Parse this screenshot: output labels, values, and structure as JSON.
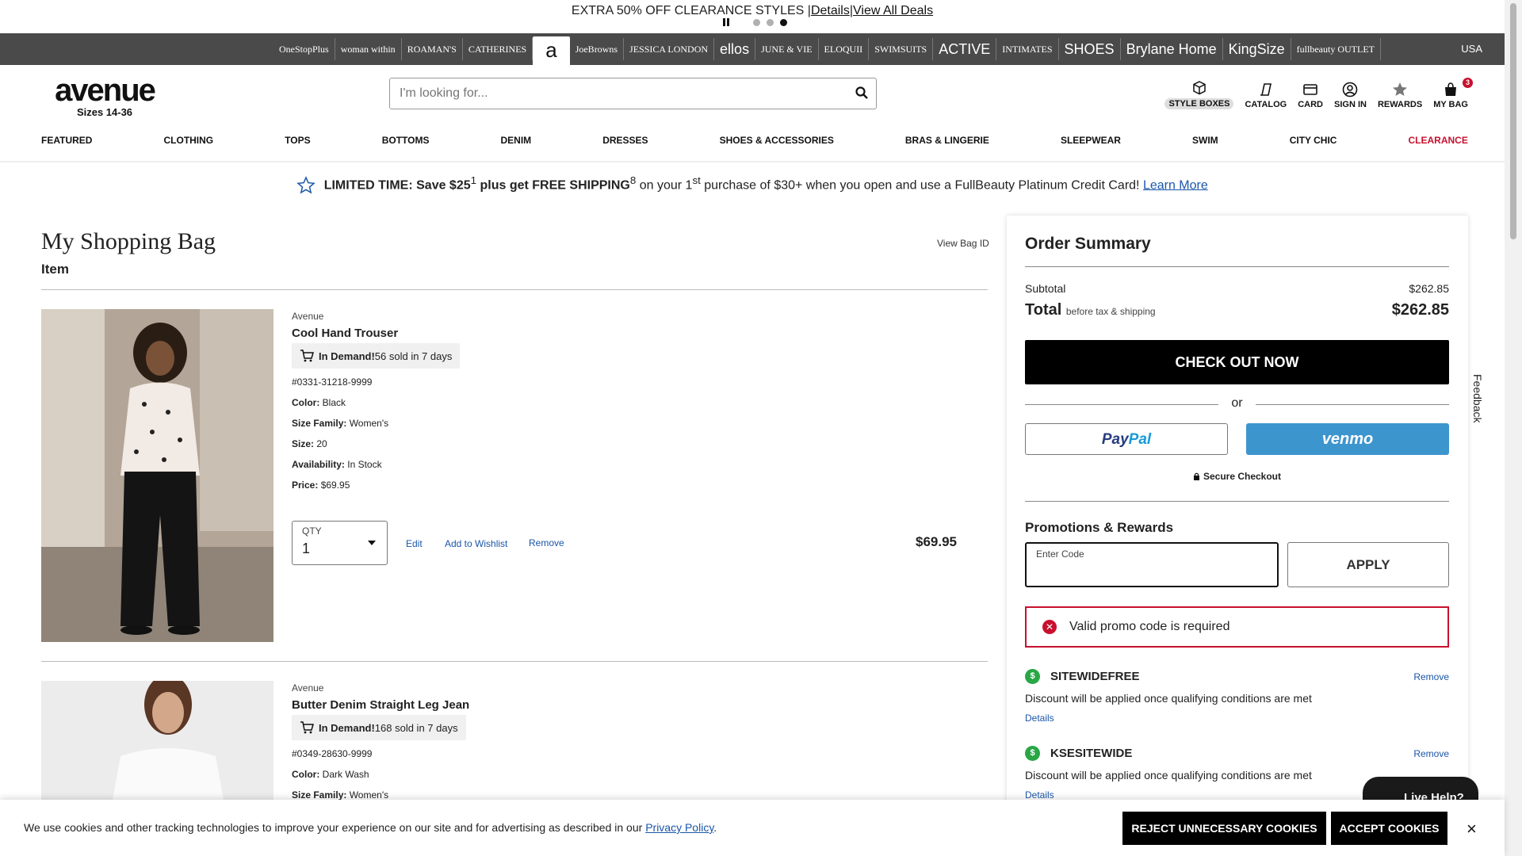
{
  "promo": {
    "message": "EXTRA 50% OFF CLEARANCE STYLES",
    "details_link": "Details",
    "view_all_link": "View All Deals"
  },
  "brands": [
    {
      "label": "OneStopPlus",
      "style": "small"
    },
    {
      "label": "woman within",
      "style": "small"
    },
    {
      "label": "ROAMAN'S",
      "style": "small"
    },
    {
      "label": "CATHERINES",
      "style": "small"
    },
    {
      "label": "a",
      "style": "selected"
    },
    {
      "label": "JoeBrowns",
      "style": "small"
    },
    {
      "label": "JESSICA LONDON",
      "style": "small"
    },
    {
      "label": "ellos",
      "style": "big"
    },
    {
      "label": "JUNE & VIE",
      "style": "small"
    },
    {
      "label": "ELOQUII",
      "style": "small"
    },
    {
      "label": "SWIMSUITS",
      "style": "small"
    },
    {
      "label": "ACTIVE",
      "style": "big"
    },
    {
      "label": "INTIMATES",
      "style": "small"
    },
    {
      "label": "SHOES",
      "style": "big"
    },
    {
      "label": "Brylane Home",
      "style": "big"
    },
    {
      "label": "KingSize",
      "style": "big"
    },
    {
      "label": "fullbeauty OUTLET",
      "style": "small"
    }
  ],
  "region": "USA",
  "header": {
    "logo_word": "avenue",
    "logo_sizes": "Sizes 14-36",
    "search_placeholder": "I'm looking for...",
    "utility": {
      "style_boxes": "STYLE BOXES",
      "catalog": "CATALOG",
      "card": "CARD",
      "sign_in": "SIGN IN",
      "rewards": "REWARDS",
      "my_bag": "MY BAG",
      "bag_count": "3"
    }
  },
  "nav": [
    "FEATURED",
    "CLOTHING",
    "TOPS",
    "BOTTOMS",
    "DENIM",
    "DRESSES",
    "SHOES & ACCESSORIES",
    "BRAS & LINGERIE",
    "SLEEPWEAR",
    "SWIM",
    "CITY CHIC",
    "CLEARANCE"
  ],
  "limited": {
    "bold": "LIMITED TIME: Save $25",
    "sup1": "1",
    "mid": " plus get FREE SHIPPING",
    "sup2": "8",
    "rest1": " on your 1",
    "sup3": "st",
    "rest2": " purchase of $30+ when you open and use a FullBeauty Platinum Credit Card! ",
    "link": "Learn More"
  },
  "cart": {
    "title": "My Shopping Bag",
    "item_heading": "Item",
    "view_bag_id": "View Bag ID",
    "items": [
      {
        "brand": "Avenue",
        "name": "Cool Hand Trouser",
        "demand_bold": "In Demand!",
        "demand_text": " 56 sold in 7 days",
        "sku": "#0331-31218-9999",
        "color_label": "Color:",
        "color": " Black",
        "size_family_label": "Size Family:",
        "size_family": " Women's",
        "size_label": "Size:",
        "size": " 20",
        "availability_label": "Availability:",
        "availability": " In Stock",
        "price_label": "Price:",
        "price": " $69.95",
        "qty_label": "QTY",
        "qty": "1",
        "edit": "Edit",
        "wishlist": "Add to Wishlist",
        "remove": "Remove",
        "line_total": "$69.95"
      },
      {
        "brand": "Avenue",
        "name": "Butter Denim Straight Leg Jean",
        "demand_bold": "In Demand!",
        "demand_text": " 168 sold in 7 days",
        "sku": "#0349-28630-9999",
        "color_label": "Color:",
        "color": " Dark Wash",
        "size_family_label": "Size Family:",
        "size_family": " Women's"
      }
    ]
  },
  "summary": {
    "title": "Order Summary",
    "subtotal_label": "Subtotal",
    "subtotal": "$262.85",
    "total_label": "Total",
    "total_note": "before tax & shipping",
    "total": "$262.85",
    "checkout": "CHECK OUT NOW",
    "or": "or",
    "paypal_pay": "Pay",
    "paypal_pal": "Pal",
    "venmo": "venmo",
    "secure": "Secure Checkout",
    "promo_title": "Promotions & Rewards",
    "code_label": "Enter Code",
    "code_value": "",
    "apply": "APPLY",
    "error": "Valid promo code is required",
    "codes": [
      {
        "name": "SITEWIDEFREE",
        "remove": "Remove",
        "desc": "Discount will be applied once qualifying conditions are met",
        "details": "Details"
      },
      {
        "name": "KSESITEWIDE",
        "remove": "Remove",
        "desc": "Discount will be applied once qualifying conditions are met",
        "details": "Details"
      }
    ]
  },
  "feedback": "Feedback",
  "live_help": "Live Help?",
  "cookie": {
    "text": "We use cookies and other tracking technologies to improve your experience on our site and for advertising as described in our ",
    "link": "Privacy Policy",
    "end": ".",
    "reject": "REJECT UNNECESSARY COOKIES",
    "accept": "ACCEPT COOKIES",
    "close": "×"
  },
  "colors": {
    "accent_red": "#c8102e",
    "link_blue": "#1a56a8",
    "venmo_blue": "#3d95ce",
    "brand_bar": "#4a4a4a"
  }
}
